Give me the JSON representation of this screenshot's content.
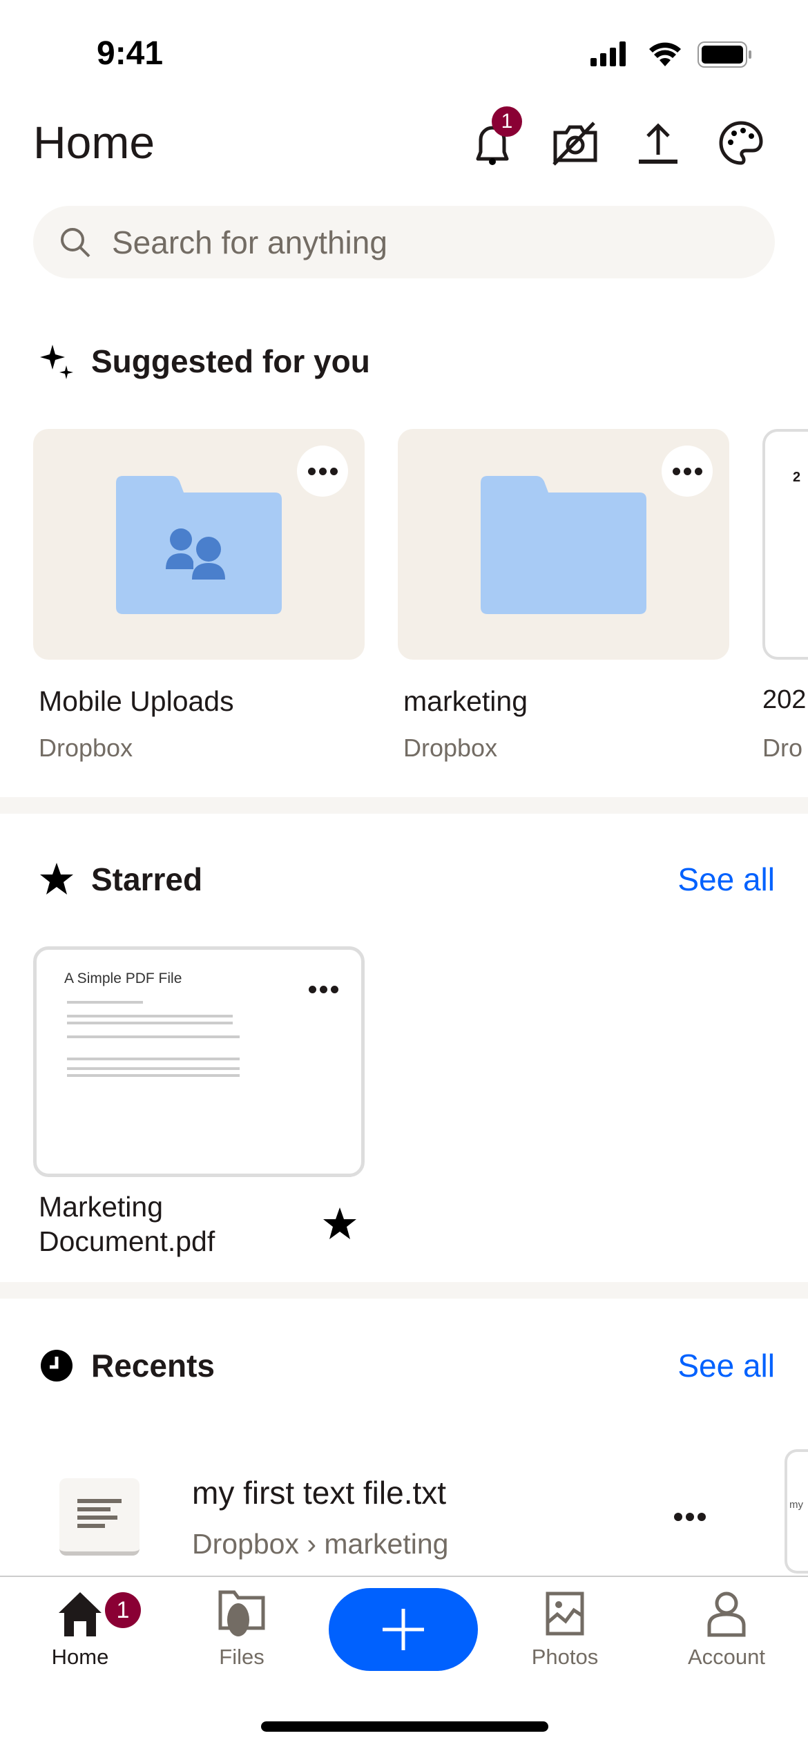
{
  "status_bar": {
    "time": "9:41"
  },
  "header": {
    "title": "Home",
    "notification_count": "1"
  },
  "search": {
    "placeholder": "Search for anything"
  },
  "suggested": {
    "heading": "Suggested for you",
    "items": [
      {
        "name": "Mobile Uploads",
        "location": "Dropbox",
        "type": "shared-folder"
      },
      {
        "name": "marketing",
        "location": "Dropbox",
        "type": "folder"
      },
      {
        "name": "202",
        "location": "Dro",
        "type": "document",
        "thumb_text": "2"
      }
    ]
  },
  "starred": {
    "heading": "Starred",
    "see_all": "See all",
    "items": [
      {
        "name_line1": "Marketing",
        "name_line2": "Document.pdf",
        "preview_title": "A Simple PDF File"
      }
    ]
  },
  "recents": {
    "heading": "Recents",
    "see_all": "See all",
    "items": [
      {
        "name": "my first text file.txt",
        "path": "Dropbox › marketing",
        "side_thumb": "my"
      }
    ]
  },
  "tabbar": {
    "items": [
      {
        "label": "Home",
        "badge": "1"
      },
      {
        "label": "Files"
      },
      {
        "label": "Photos"
      },
      {
        "label": "Account"
      }
    ]
  },
  "colors": {
    "accent": "#0061fe",
    "badge": "#8a0034",
    "folder": "#a8cbf5",
    "card_bg": "#f4efe8"
  }
}
